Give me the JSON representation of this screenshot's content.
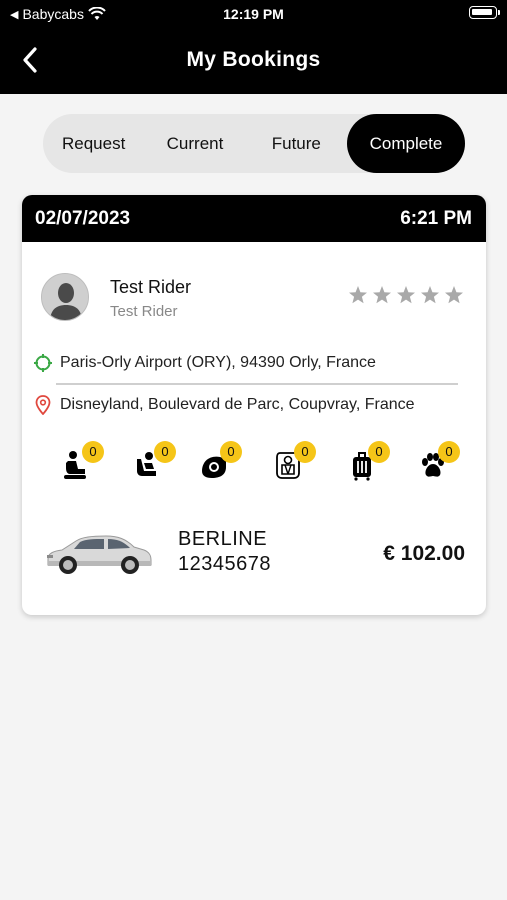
{
  "status_bar": {
    "carrier": "Babycabs",
    "time": "12:19 PM"
  },
  "nav": {
    "title": "My Bookings"
  },
  "tabs": [
    {
      "label": "Request"
    },
    {
      "label": "Current"
    },
    {
      "label": "Future"
    },
    {
      "label": "Complete"
    }
  ],
  "active_tab": "Complete",
  "booking": {
    "date": "02/07/2023",
    "time": "6:21 PM",
    "rider_name": "Test Rider",
    "rider_subtitle": "Test Rider",
    "rating": 0,
    "max_rating": 5,
    "pickup": "Paris-Orly Airport (ORY), 94390 Orly, France",
    "dropoff": "Disneyland, Boulevard de Parc, Coupvray, France",
    "amenities": [
      {
        "icon": "booster-seat-icon",
        "count": "0"
      },
      {
        "icon": "infant-carrier-icon",
        "count": "0"
      },
      {
        "icon": "baby-capsule-icon",
        "count": "0"
      },
      {
        "icon": "car-seat-icon",
        "count": "0"
      },
      {
        "icon": "luggage-icon",
        "count": "0"
      },
      {
        "icon": "pet-paw-icon",
        "count": "0"
      }
    ],
    "vehicle_type": "BERLINE",
    "vehicle_number": "12345678",
    "price": "€ 102.00"
  },
  "colors": {
    "accent": "#000000",
    "badge": "#f5c518",
    "pickup_icon": "#3aa845",
    "dropoff_icon": "#e0483e",
    "star": "#a9a9a9"
  }
}
